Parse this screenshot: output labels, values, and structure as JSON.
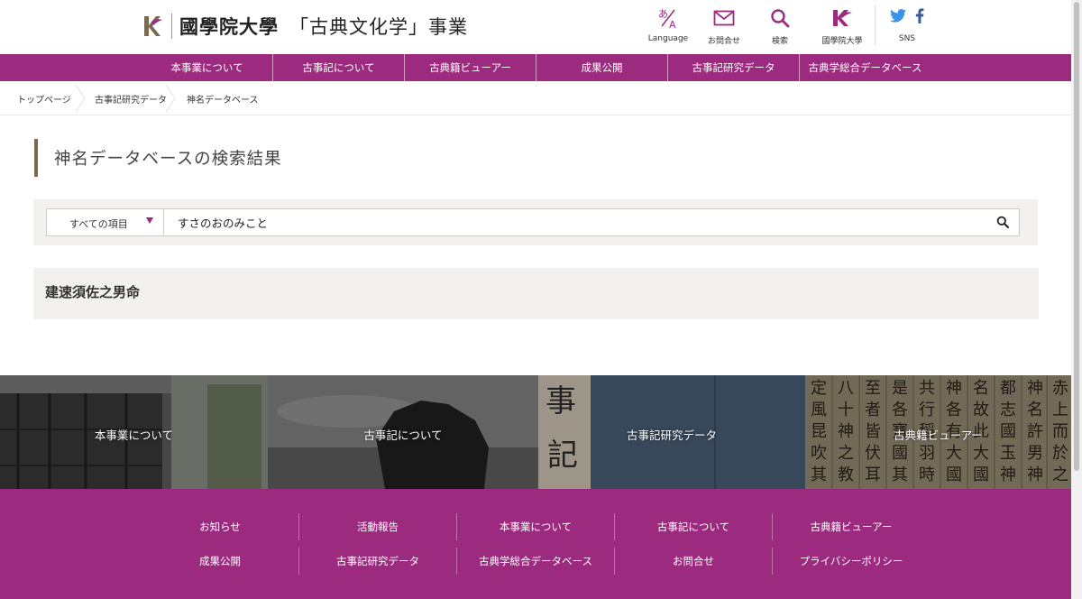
{
  "header": {
    "university_name": "國學院大學",
    "project_name": "「古典文化学」事業",
    "icons": [
      {
        "name": "language",
        "label": "Language"
      },
      {
        "name": "mail",
        "label": "お問合せ"
      },
      {
        "name": "search",
        "label": "検索"
      },
      {
        "name": "kokugakuin",
        "label": "國學院大學"
      }
    ],
    "sns_label": "SNS"
  },
  "nav": {
    "items": [
      "本事業について",
      "古事記について",
      "古典籍ビューアー",
      "成果公開",
      "古事記研究データ",
      "古典学総合データベース"
    ]
  },
  "breadcrumb": {
    "items": [
      "トップページ",
      "古事記研究データ",
      "神名データベース"
    ]
  },
  "page": {
    "title": "神名データベースの検索結果"
  },
  "search": {
    "scope": "すべての項目",
    "query": "すさのおのみこと"
  },
  "results": [
    {
      "name": "建速須佐之男命"
    }
  ],
  "tiles": [
    {
      "label": "本事業について"
    },
    {
      "label": "古事記について"
    },
    {
      "label": "古事記研究データ"
    },
    {
      "label": "古典籍ビューアー"
    }
  ],
  "footer": {
    "row1": [
      "お知らせ",
      "活動報告",
      "本事業について",
      "古事記について",
      "古典籍ビューアー"
    ],
    "row2": [
      "成果公開",
      "古事記研究データ",
      "古典学総合データベース",
      "お問合せ",
      "プライバシーポリシー"
    ]
  },
  "colors": {
    "brand": "#9c2a7e",
    "accent_bar": "#7a6a52",
    "panel_bg": "#f2f1ef"
  }
}
